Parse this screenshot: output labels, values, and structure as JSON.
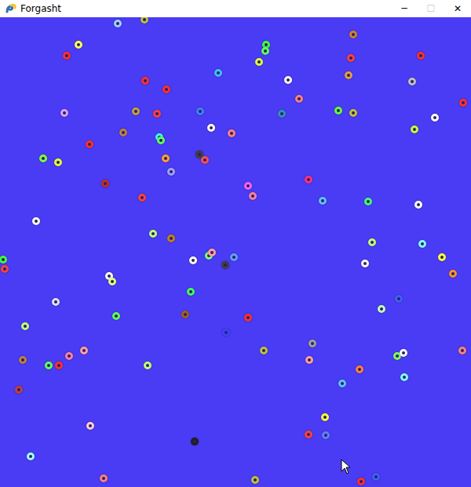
{
  "window": {
    "title": "Forgasht"
  },
  "controls": [
    {
      "label": "─",
      "disabled": false
    },
    {
      "label": "☐",
      "disabled": true
    },
    {
      "label": "✕",
      "disabled": false
    }
  ],
  "dots": [
    {
      "color": "#a0d0ff"
    },
    {
      "color": "#c0c040"
    },
    {
      "color": "#ffff60"
    },
    {
      "color": "#ff3030"
    },
    {
      "color": "#40ff40"
    },
    {
      "color": "#60ff60"
    },
    {
      "color": "#e0ff40"
    },
    {
      "color": "#d08030"
    },
    {
      "color": "#ff4040"
    },
    {
      "color": "#ff3030"
    },
    {
      "color": "#e0a040"
    },
    {
      "color": "#40c0ff"
    },
    {
      "color": "#ffffff"
    },
    {
      "color": "#ff3030"
    },
    {
      "color": "#ff3030"
    },
    {
      "color": "#c0c0c0"
    },
    {
      "color": "#e0a0ff"
    },
    {
      "color": "#c0a040"
    },
    {
      "color": "#ff4040"
    },
    {
      "color": "#4080ff"
    },
    {
      "color": "#ff8080"
    },
    {
      "color": "#3090c0"
    },
    {
      "color": "#60ff40"
    },
    {
      "color": "#c0c040"
    },
    {
      "color": "#ff3030"
    },
    {
      "color": "#ffffff"
    },
    {
      "color": "#ffffff"
    },
    {
      "color": "#c08040"
    },
    {
      "color": "#ff8080"
    },
    {
      "color": "#40ffff"
    },
    {
      "color": "#60ff60"
    },
    {
      "color": "#ff3030"
    },
    {
      "color": "#c0ff40"
    },
    {
      "color": "#80ff40"
    },
    {
      "color": "#e0ff40"
    },
    {
      "color": "#ffa030"
    },
    {
      "color": "#404040"
    },
    {
      "color": "#ff5050"
    },
    {
      "color": "#a0a0ff"
    },
    {
      "color": "#c03020"
    },
    {
      "color": "#ff60ff"
    },
    {
      "color": "#ff3080"
    },
    {
      "color": "#ff4040"
    },
    {
      "color": "#ff80a0"
    },
    {
      "color": "#60c0ff"
    },
    {
      "color": "#40ff80"
    },
    {
      "color": "#ffffff"
    },
    {
      "color": "#ffffff"
    },
    {
      "color": "#c0ff80"
    },
    {
      "color": "#c08020"
    },
    {
      "color": "#c0ff80"
    },
    {
      "color": "#80ffff"
    },
    {
      "color": "#ffff40"
    },
    {
      "color": "#ffffff"
    },
    {
      "color": "#80ff80"
    },
    {
      "color": "#ffa0a0"
    },
    {
      "color": "#60a0ff"
    },
    {
      "color": "#404040"
    },
    {
      "color": "#ffffff"
    },
    {
      "color": "#ff9030"
    },
    {
      "color": "#40ff40"
    },
    {
      "color": "#ff4040"
    },
    {
      "color": "#ffffff"
    },
    {
      "color": "#e0ff80"
    },
    {
      "color": "#40ff60"
    },
    {
      "color": "#e0e0ff"
    },
    {
      "color": "#4060ff"
    },
    {
      "color": "#c0ffc0"
    },
    {
      "color": "#60ff60"
    },
    {
      "color": "#a06020"
    },
    {
      "color": "#ff3030"
    },
    {
      "color": "#c0ff80"
    },
    {
      "color": "#4040ff"
    },
    {
      "color": "#a0a0a0"
    },
    {
      "color": "#c0c040"
    },
    {
      "color": "#ffa0a0"
    },
    {
      "color": "#ff80a0"
    },
    {
      "color": "#c08040"
    },
    {
      "color": "#60ff60"
    },
    {
      "color": "#ff3030"
    },
    {
      "color": "#c0ff80"
    },
    {
      "color": "#ffa0a0"
    },
    {
      "color": "#ff8040"
    },
    {
      "color": "#80ff60"
    },
    {
      "color": "#ffffff"
    },
    {
      "color": "#80ffff"
    },
    {
      "color": "#ff8080"
    },
    {
      "color": "#60c0ff"
    },
    {
      "color": "#c04040"
    },
    {
      "color": "#ffff40"
    },
    {
      "color": "#ffd0d0"
    },
    {
      "color": "#ff4040"
    },
    {
      "color": "#6080ff"
    },
    {
      "color": "#202020"
    },
    {
      "color": "#a0ffff"
    },
    {
      "color": "#ff8080"
    },
    {
      "color": "#c0c040"
    },
    {
      "color": "#ff3030"
    },
    {
      "color": "#4060ff"
    }
  ]
}
